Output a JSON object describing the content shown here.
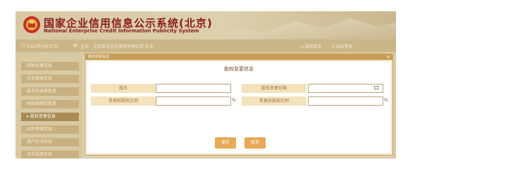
{
  "header": {
    "title_cn": "国家企业信用信息公示系统(北京)",
    "title_en": "National Enterprise Credit Information Publicity System"
  },
  "subbar": {
    "date": "2022年4月27日",
    "company": "企业：北京鼎吉信达商贸有限公司 企业",
    "right_a": "返回首页",
    "right_b": "退出登录"
  },
  "sidebar": {
    "items": [
      {
        "label": "特种设备信息"
      },
      {
        "label": "企业基本信息"
      },
      {
        "label": "股东及出资信息"
      },
      {
        "label": "网站或网店信息"
      },
      {
        "label": "股权变更信息"
      },
      {
        "label": "对外担保信息"
      },
      {
        "label": "资产状况信息"
      },
      {
        "label": "对外投资信息"
      }
    ],
    "active_index": 4
  },
  "dialog": {
    "head_label": "修改变更信息",
    "close": "×",
    "title": "股权变更信息",
    "fields": {
      "shareholder_label": "股东",
      "shareholder_value": "",
      "change_date_label": "股权变更日期",
      "change_date_value": "",
      "before_label": "变更前股权比例",
      "before_value": "",
      "after_label": "变更后股权比例",
      "after_value": "",
      "pct": "%"
    },
    "buttons": {
      "save": "保存",
      "cancel": "取消"
    }
  }
}
